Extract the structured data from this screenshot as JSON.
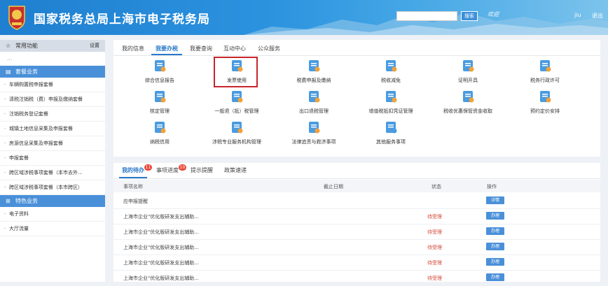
{
  "header": {
    "title": "国家税务总局上海市电子税务局",
    "search_placeholder": "",
    "search_button": "搜索",
    "welcome": "欢迎",
    "user": "jiu",
    "logout": "退出"
  },
  "sidebar": {
    "common_title": "常用功能",
    "common_settings": "设置",
    "common_placeholder": "...",
    "package_title": "套餐业务",
    "package_items": [
      "车辆购置税申报套餐",
      "清税注销税（费）申报及缴纳套餐",
      "注销税务登记套餐",
      "城镇土地信息采集及申报套餐",
      "房源信息采集及申报套餐",
      "申报套餐",
      "跨区域涉税事项套餐（本市去外...",
      "跨区域涉税事项套餐（本市跨区）"
    ],
    "special_title": "特色业务",
    "special_items": [
      "电子资料",
      "大厅流量"
    ]
  },
  "main": {
    "tabs": [
      "我的信息",
      "我要办税",
      "我要查询",
      "互动中心",
      "公众服务"
    ],
    "active_tab": "我要办税",
    "tools": [
      {
        "label": "综合信息报告",
        "icon": "report-icon"
      },
      {
        "label": "发票使用",
        "icon": "invoice-icon"
      },
      {
        "label": "税费申报及缴纳",
        "icon": "tax-declare-icon"
      },
      {
        "label": "税收减免",
        "icon": "tax-relief-icon"
      },
      {
        "label": "证明开具",
        "icon": "certificate-icon"
      },
      {
        "label": "税务行政许可",
        "icon": "license-icon"
      },
      {
        "label": "核定管理",
        "icon": "verify-icon"
      },
      {
        "label": "一般退（抵）税管理",
        "icon": "refund-icon"
      },
      {
        "label": "出口退税管理",
        "icon": "export-refund-icon"
      },
      {
        "label": "增值税抵扣凭证管理",
        "icon": "vat-deduct-icon"
      },
      {
        "label": "税收优惠保管资金收取",
        "icon": "deposit-icon"
      },
      {
        "label": "预约定价安排",
        "icon": "pricing-icon"
      },
      {
        "label": "纳税信用",
        "icon": "credit-icon"
      },
      {
        "label": "涉税专业服务机构管理",
        "icon": "agency-icon"
      },
      {
        "label": "法律追责与救济事项",
        "icon": "gavel-icon"
      },
      {
        "label": "其他服务事项",
        "icon": "heart-icon"
      }
    ]
  },
  "tasks": {
    "tabs": [
      {
        "label": "我的待办",
        "badge": "11"
      },
      {
        "label": "事项进度",
        "badge": "10"
      },
      {
        "label": "提示提醒",
        "badge": ""
      },
      {
        "label": "政策速递",
        "badge": ""
      }
    ],
    "columns": [
      "事项名称",
      "截止日期",
      "状态",
      "操作"
    ],
    "rows": [
      {
        "name": "应申报提醒",
        "status": "",
        "action": "详情"
      },
      {
        "name": "上海市企业\"优化版研发支出辅助...",
        "status": "待受理",
        "action": "办理"
      },
      {
        "name": "上海市企业\"优化版研发支出辅助...",
        "status": "待受理",
        "action": "办理"
      },
      {
        "name": "上海市企业\"优化版研发支出辅助...",
        "status": "待受理",
        "action": "办理"
      },
      {
        "name": "上海市企业\"优化版研发支出辅助...",
        "status": "待受理",
        "action": "办理"
      },
      {
        "name": "上海市企业\"优化版研发支出辅助...",
        "status": "待受理",
        "action": "办理"
      }
    ]
  },
  "colors": {
    "primary": "#4a90d9",
    "header": "#2c93df",
    "highlight": "#c9252b",
    "badge": "#e8483a",
    "pending": "#d34a3b"
  }
}
